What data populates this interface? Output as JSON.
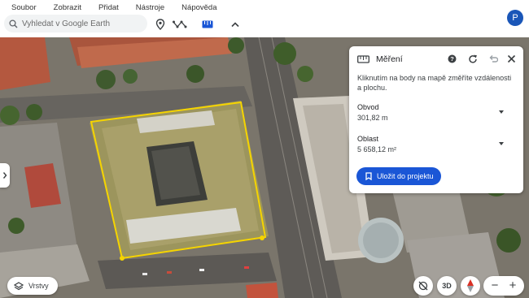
{
  "menu": {
    "items": [
      {
        "label": "Soubor"
      },
      {
        "label": "Zobrazit"
      },
      {
        "label": "Přidat"
      },
      {
        "label": "Nástroje"
      },
      {
        "label": "Nápověda"
      }
    ]
  },
  "toolbar": {
    "search_placeholder": "Vyhledat v Google Earth",
    "icons": [
      "search-icon",
      "place-pin-icon",
      "path-tool-icon",
      "measure-ruler-icon",
      "chevron-up-icon"
    ]
  },
  "user": {
    "avatar_letter": "P"
  },
  "measure_panel": {
    "title": "Měření",
    "hint": "Kliknutím na body na mapě změříte vzdálenosti a plochu.",
    "perimeter_label": "Obvod",
    "perimeter_value": "301,82 m",
    "area_label": "Oblast",
    "area_value": "5 658,12 m²",
    "save_label": "Uložit do projektu",
    "icons": [
      "ruler-icon",
      "help-icon",
      "redo-icon",
      "undo-icon",
      "close-icon"
    ]
  },
  "controls": {
    "layers_label": "Vrstvy",
    "three_d_label": "3D",
    "zoom_out": "−",
    "zoom_in": "+"
  },
  "colors": {
    "accent": "#1a56d6",
    "measure_outline": "#f5d400"
  }
}
